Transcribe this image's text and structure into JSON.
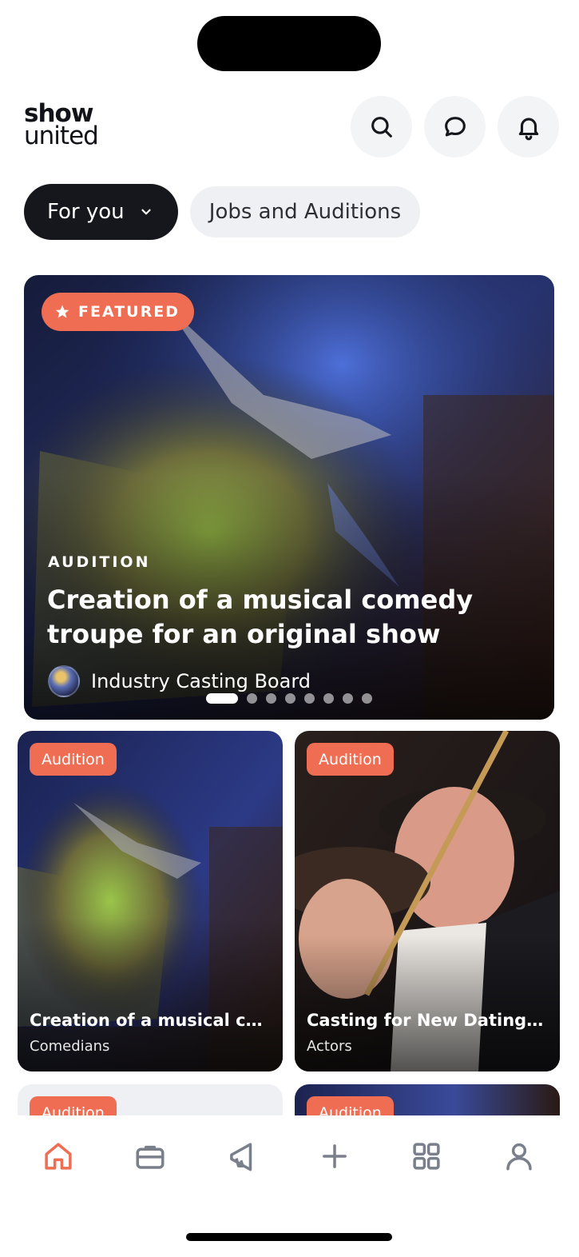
{
  "app": {
    "logo_line1": "show",
    "logo_line2": "united"
  },
  "header": {
    "icons": [
      "search-icon",
      "chat-bubble-icon",
      "bell-icon"
    ]
  },
  "filters": {
    "for_you": "For you",
    "jobs": "Jobs and Auditions"
  },
  "featured": {
    "badge": "FEATURED",
    "category": "AUDITION",
    "title": "Creation of a musical comedy troupe for an original show",
    "organization": "Industry Casting Board",
    "slide_count": 8,
    "active_slide": 1
  },
  "grid": [
    {
      "badge": "Audition",
      "title": "Creation of a musical co...",
      "subtitle": "Comedians"
    },
    {
      "badge": "Audition",
      "title": "Casting for New Dating S...",
      "subtitle": "Actors"
    },
    {
      "badge": "Audition"
    },
    {
      "badge": "Audition"
    }
  ],
  "tabbar": {
    "items": [
      "home-icon",
      "briefcase-icon",
      "megaphone-icon",
      "plus-icon",
      "grid-icon",
      "profile-icon"
    ],
    "active": "home-icon"
  },
  "colors": {
    "accent": "#ef6e53",
    "dark": "#16171d",
    "chip_light": "#eef0f3",
    "tab_inactive": "#7a7f8c"
  }
}
